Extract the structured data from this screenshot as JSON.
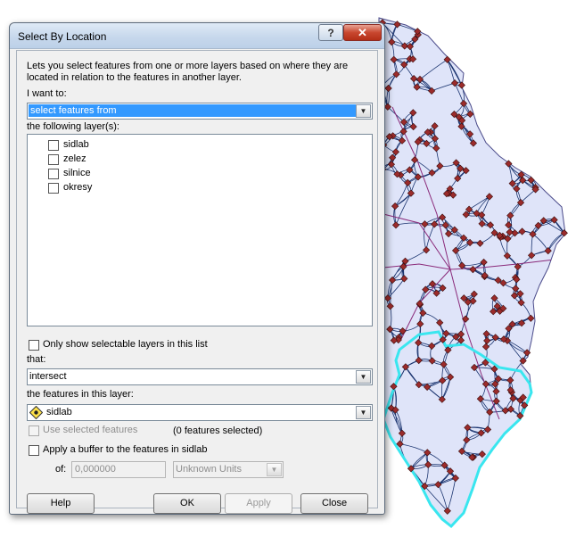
{
  "dialog": {
    "title": "Select By Location",
    "help_icon": "?",
    "close_icon": "✕",
    "description": "Lets you select features from one or more layers based on where they are located in relation to the features in another layer.",
    "i_want_to_label": "I want to:",
    "method_value": "select features from",
    "layers_label": "the following layer(s):",
    "layers": [
      {
        "name": "sidlab",
        "checked": false
      },
      {
        "name": "zelez",
        "checked": false
      },
      {
        "name": "silnice",
        "checked": false
      },
      {
        "name": "okresy",
        "checked": false
      }
    ],
    "only_selectable_label": "Only show selectable layers in this list",
    "that_label": "that:",
    "relation_value": "intersect",
    "features_label": "the features in this layer:",
    "source_layer_value": "sidlab",
    "source_layer_icon": "point-layer-icon",
    "use_selected_label": "Use selected features",
    "features_selected_text": "(0 features selected)",
    "buffer_label": "Apply a buffer to the features in sidlab",
    "of_label": "of:",
    "buffer_value": "0,000000",
    "units_value": "Unknown Units",
    "buttons": {
      "help": "Help",
      "ok": "OK",
      "apply": "Apply",
      "close": "Close"
    }
  },
  "map": {
    "fill_color": "#dfe4f9",
    "outline_color": "#4b4b8a",
    "roads_color": "#1c3570",
    "rail_color": "#8a2a7a",
    "points_color": "#9b2b2b",
    "highlight_color": "#39e6ef"
  }
}
